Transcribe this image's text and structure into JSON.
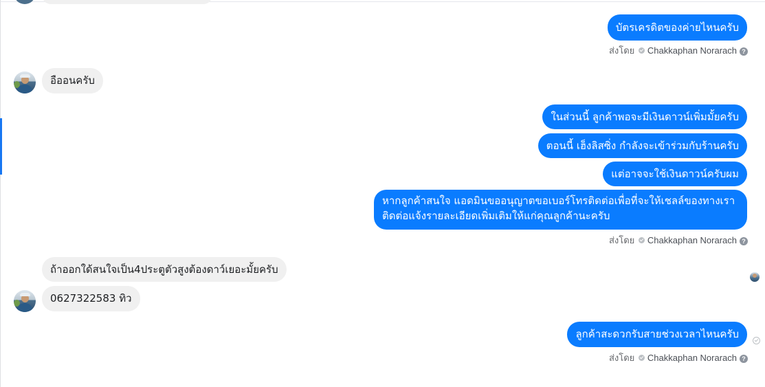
{
  "conversation": {
    "messages": [
      {
        "id": "m1",
        "direction": "out",
        "text": "บัตรเครดิตของค่ายไหนครับ"
      },
      {
        "id": "m2",
        "direction": "in",
        "text": "อืออนครับ"
      },
      {
        "id": "m3",
        "direction": "out",
        "text": "ในส่วนนี้ ลูกค้าพอจะมีเงินดาวน์เพิ่มมั้ยครับ"
      },
      {
        "id": "m4",
        "direction": "out",
        "text": "ตอนนี้ เฮ็งลิสซิ่ง กำลังจะเข้าร่วมกับร้านครับ"
      },
      {
        "id": "m5",
        "direction": "out",
        "text": "แต่อาจจะใช้เงินดาวน์ครับผม"
      },
      {
        "id": "m6",
        "direction": "out",
        "text": "หากลูกค้าสนใจ แอดมินขออนุญาตขอเบอร์โทรติดต่อเพื่อที่จะให้เชลล์ของทางเราติดต่อแจ้งรายละเอียดเพิ่มเติมให้แก่คุณลูกค้านะครับ"
      },
      {
        "id": "m7",
        "direction": "in",
        "text": "ถ้าออกใด้สนใจเป็น4ประตูตัวสูงต้องดาว์เยอะมั้ยครับ"
      },
      {
        "id": "m8",
        "direction": "in",
        "text": "0627322583 ทิว"
      },
      {
        "id": "m9",
        "direction": "out",
        "text": "ลูกค้าสะดวกรับสายช่วงเวลาไหนครับ"
      }
    ],
    "sent_by": {
      "prefix": "ส่งโดย",
      "name": "Chakkaphan Norarach",
      "help_symbol": "?"
    }
  },
  "colors": {
    "outgoing_bubble": "#0a7cff",
    "incoming_bubble": "#f0f0f0",
    "meta_text": "#65676b"
  },
  "icons": {
    "verified": "check-circle-icon",
    "help": "question-circle-icon",
    "seen": "seen-check-icon"
  }
}
